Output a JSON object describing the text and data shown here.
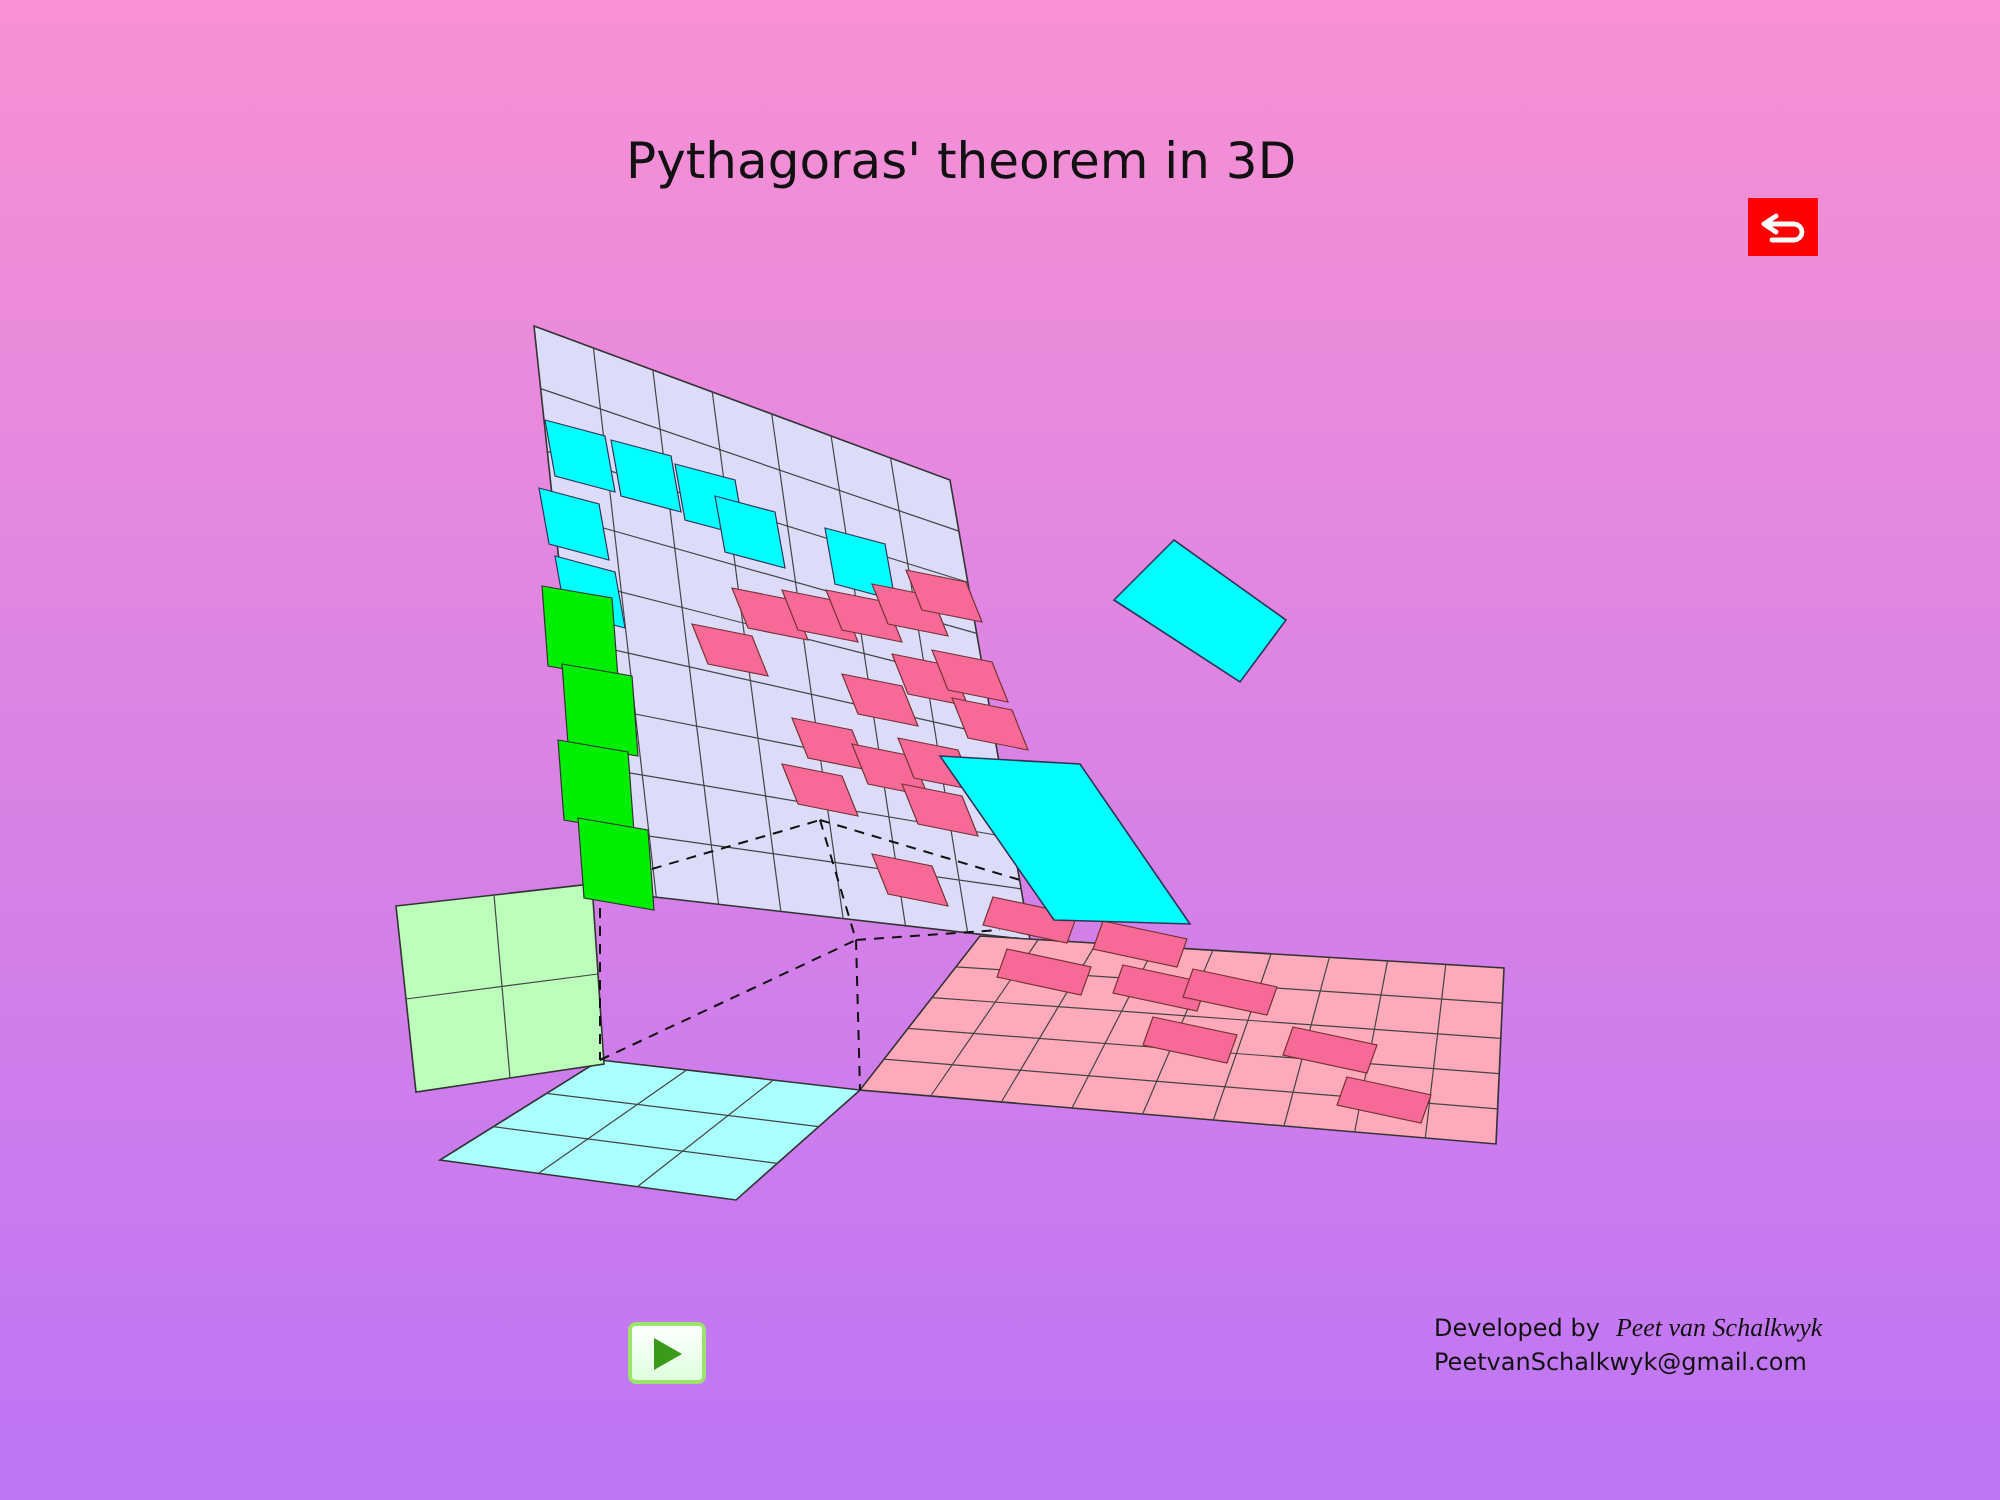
{
  "title": "Pythagoras' theorem in 3D",
  "credit": {
    "label": "Developed by",
    "author": "Peet van Schalkwyk",
    "email": "PeetvanSchalkwyk@gmail.com"
  }
}
